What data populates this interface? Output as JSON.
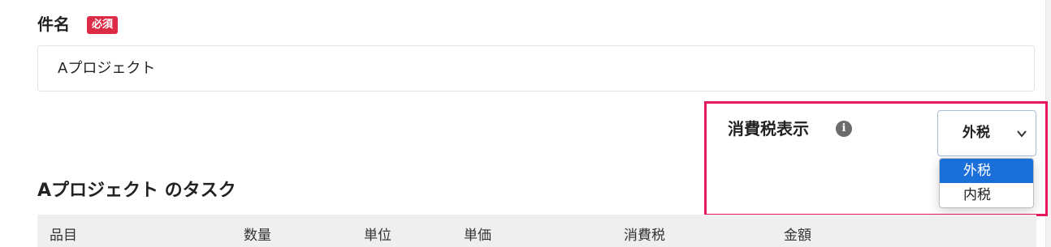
{
  "form": {
    "name_label": "件名",
    "required_badge": "必須",
    "name_value": "Aプロジェクト"
  },
  "tax_display": {
    "label": "消費税表示",
    "info_icon": "info-icon",
    "selected_value": "外税",
    "options": [
      "外税",
      "内税"
    ],
    "highlight_color": "#e6195e",
    "option_selected_color": "#1a6fd9"
  },
  "tasks": {
    "section_title": "Aプロジェクト のタスク",
    "columns": [
      "品目",
      "数量",
      "単位",
      "単価",
      "消費税",
      "金額"
    ]
  },
  "colors": {
    "required_badge": "#dc2b45"
  }
}
